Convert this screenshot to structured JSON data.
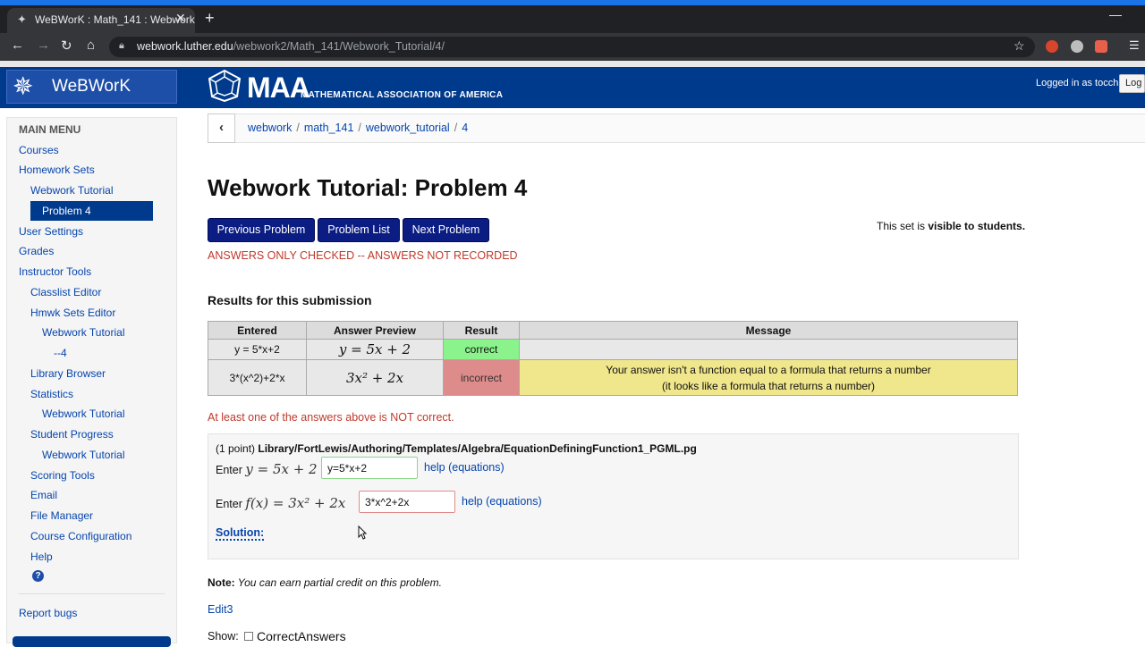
{
  "browser": {
    "tab_title": "WeBWorK : Math_141 : Webwork",
    "url_host": "webwork.luther.edu",
    "url_path": "/webwork2/Math_141/Webwork_Tutorial/4/"
  },
  "header": {
    "logo_text": "WeBWorK",
    "maa_short": "MAA",
    "maa_full": "MATHEMATICAL ASSOCIATION OF AMERICA",
    "logged_in": "Logged in as tocchi",
    "log_button": "Log"
  },
  "sidebar": {
    "title": "MAIN MENU",
    "items": [
      {
        "label": "Courses"
      },
      {
        "label": "Homework Sets"
      },
      {
        "label": "Webwork Tutorial"
      },
      {
        "label": "Problem 4"
      },
      {
        "label": "User Settings"
      },
      {
        "label": "Grades"
      },
      {
        "label": "Instructor Tools"
      },
      {
        "label": "Classlist Editor"
      },
      {
        "label": "Hmwk Sets Editor"
      },
      {
        "label": "Webwork Tutorial"
      },
      {
        "label": "--4"
      },
      {
        "label": "Library Browser"
      },
      {
        "label": "Statistics"
      },
      {
        "label": "Webwork Tutorial"
      },
      {
        "label": "Student Progress"
      },
      {
        "label": "Webwork Tutorial"
      },
      {
        "label": "Scoring Tools"
      },
      {
        "label": "Email"
      },
      {
        "label": "File Manager"
      },
      {
        "label": "Course Configuration"
      },
      {
        "label": "Help"
      }
    ],
    "help_icon": "?",
    "report_bugs": "Report bugs"
  },
  "breadcrumb": [
    "webwork",
    "math_141",
    "webwork_tutorial",
    "4"
  ],
  "main": {
    "title": "Webwork Tutorial: Problem 4",
    "buttons": {
      "prev": "Previous Problem",
      "list": "Problem List",
      "next": "Next Problem"
    },
    "visibility_prefix": "This set is ",
    "visibility_value": "visible to students.",
    "not_recorded": "ANSWERS ONLY CHECKED -- ANSWERS NOT RECORDED",
    "results_heading": "Results for this submission",
    "table": {
      "headers": [
        "Entered",
        "Answer Preview",
        "Result",
        "Message"
      ],
      "rows": [
        {
          "entered": "y = 5*x+2",
          "preview": "y = 5x + 2",
          "result": "correct",
          "message_1": "",
          "message_2": ""
        },
        {
          "entered": "3*(x^2)+2*x",
          "preview": "3x² + 2x",
          "result": "incorrect",
          "message_1": "Your answer isn't a function equal to a formula that returns a number",
          "message_2": "(it looks like a formula that returns a number)"
        }
      ]
    },
    "not_correct": "At least one of the answers above is NOT correct.",
    "problem": {
      "points": "(1 point) ",
      "path": "Library/FortLewis/Authoring/Templates/Algebra/EquationDefiningFunction1_PGML.pg",
      "enter_label": "Enter",
      "q1_math": "y = 5x + 2",
      "q1_answer": "y=5*x+2",
      "q2_math": "f(x) = 3x² + 2x",
      "q2_answer": "3*x^2+2x",
      "help_label": "help (equations)",
      "solution_label": "Solution:"
    },
    "note_label": "Note:",
    "note_text": " You can earn partial credit on this problem.",
    "edit_link": "Edit3",
    "show_label": "Show:",
    "show_option": "CorrectAnswers"
  }
}
